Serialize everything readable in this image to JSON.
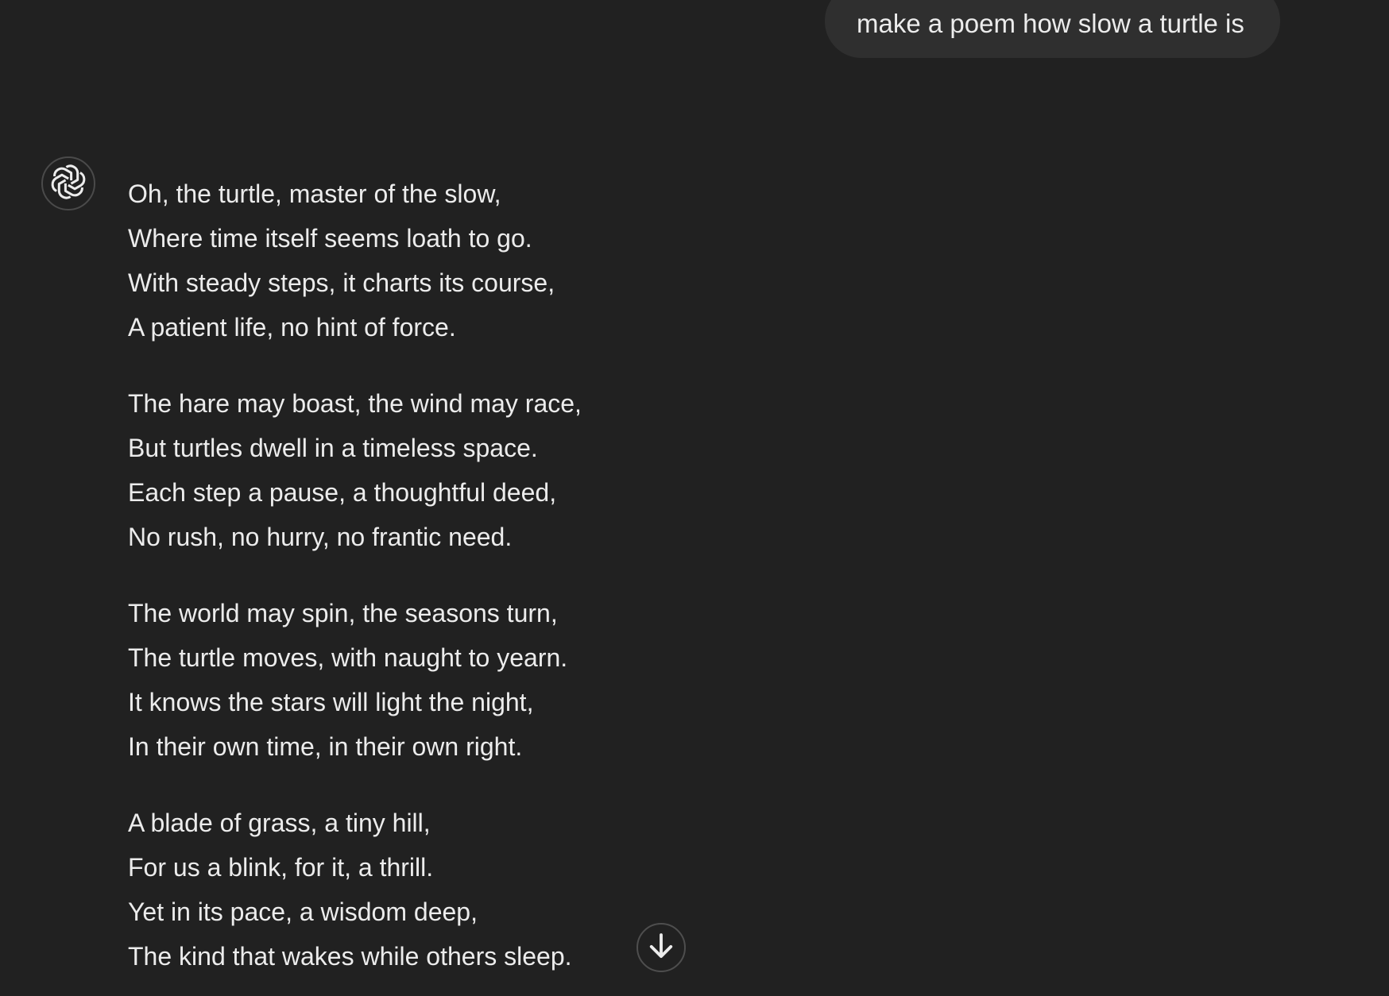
{
  "user_message": {
    "text": "make a poem how slow a turtle is"
  },
  "assistant": {
    "avatar_icon": "openai-logo-icon",
    "stanzas": [
      {
        "lines": [
          "Oh, the turtle, master of the slow,",
          "Where time itself seems loath to go.",
          "With steady steps, it charts its course,",
          "A patient life, no hint of force."
        ]
      },
      {
        "lines": [
          "The hare may boast, the wind may race,",
          "But turtles dwell in a timeless space.",
          "Each step a pause, a thoughtful deed,",
          "No rush, no hurry, no frantic need."
        ]
      },
      {
        "lines": [
          "The world may spin, the seasons turn,",
          "The turtle moves, with naught to yearn.",
          "It knows the stars will light the night,",
          "In their own time, in their own right."
        ]
      },
      {
        "lines": [
          "A blade of grass, a tiny hill,",
          "For us a blink, for it, a thrill.",
          "Yet in its pace, a wisdom deep,",
          "The kind that wakes while others sleep."
        ]
      }
    ]
  },
  "scroll_button": {
    "icon": "arrow-down-icon"
  },
  "colors": {
    "background": "#212121",
    "bubble": "#2f2f2f",
    "text": "#ececec"
  }
}
